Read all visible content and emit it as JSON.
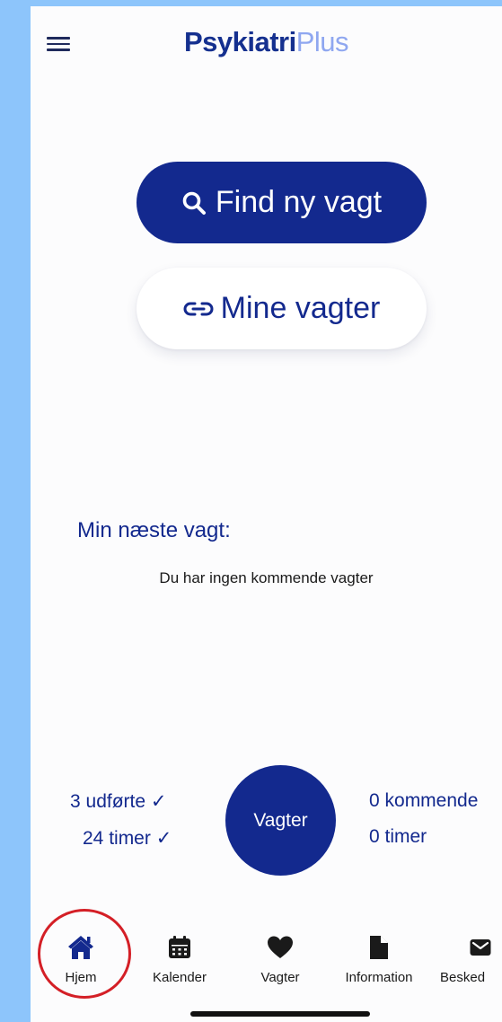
{
  "app": {
    "logo_bold": "Psykiatri",
    "logo_light": "Plus",
    "brand_color": "#13298e",
    "logo_light_color": "#8fa7f0"
  },
  "header": {
    "menu_icon": "hamburger-menu-icon"
  },
  "actions": {
    "find_label": "Find ny vagt",
    "find_icon": "search-icon",
    "mine_label": "Mine vagter",
    "mine_icon": "link-icon"
  },
  "next_shift": {
    "title": "Min næste vagt:",
    "empty_text": "Du har ingen kommende vagter"
  },
  "stats": {
    "completed": "3 udførte",
    "completed_hours": "24 timer",
    "check_mark": "✓",
    "center_button": "Vagter",
    "upcoming": "0 kommende",
    "upcoming_hours": "0 timer"
  },
  "tabbar": {
    "items": [
      {
        "label": "Hjem",
        "icon": "home-icon",
        "active": true
      },
      {
        "label": "Kalender",
        "icon": "calendar-icon",
        "active": false
      },
      {
        "label": "Vagter",
        "icon": "heart-icon",
        "active": false
      },
      {
        "label": "Information",
        "icon": "document-icon",
        "active": false
      },
      {
        "label": "Besked",
        "icon": "mail-icon",
        "active": false
      }
    ]
  },
  "annotation": {
    "highlight_color": "#d41f26"
  }
}
